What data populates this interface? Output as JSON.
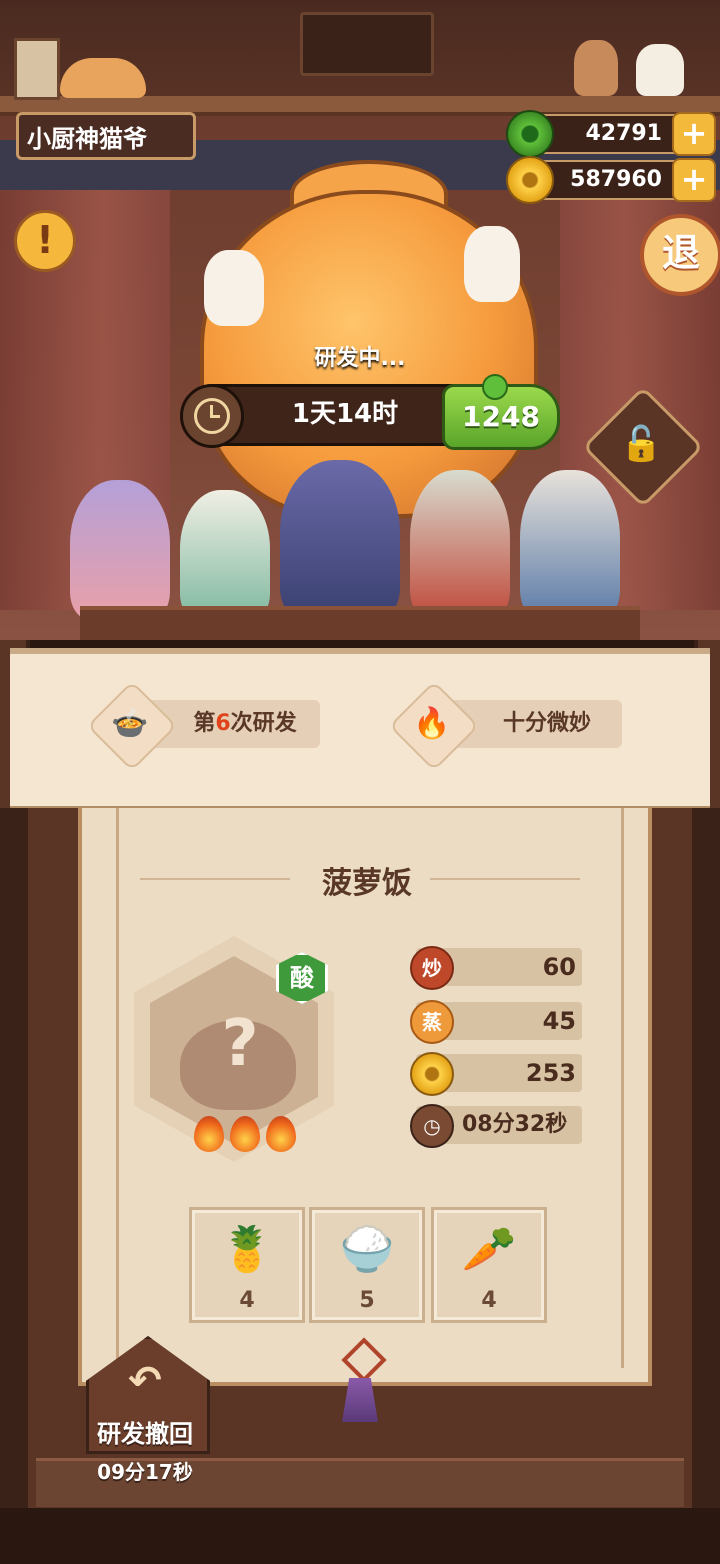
{
  "header": {
    "player_name": "小厨神猫爷",
    "jade_amount": "42791",
    "coin_amount": "587960",
    "plus_label": "+",
    "alert_label": "!",
    "exit_label": "退"
  },
  "research": {
    "status": "研发中...",
    "time_remaining": "1天14时",
    "speedup_cost": "1248"
  },
  "banner": {
    "attempt_prefix": "第",
    "attempt_number": "6",
    "attempt_suffix": "次研发",
    "hint": "十分微妙"
  },
  "dish": {
    "name": "菠萝饭",
    "flavor_tag": "酸",
    "unknown_mark": "?",
    "flame_count": 3,
    "stats": {
      "stir_fry_label": "炒",
      "stir_fry": "60",
      "steam_label": "蒸",
      "steam": "45",
      "price": "253",
      "cook_time": "08分32秒"
    },
    "ingredients": [
      {
        "icon": "pineapple-banana-icon",
        "count": "4"
      },
      {
        "icon": "rice-bowl-icon",
        "count": "5"
      },
      {
        "icon": "carrot-icon",
        "count": "4"
      }
    ]
  },
  "undo": {
    "label": "研发撤回",
    "timer": "09分17秒"
  },
  "colors": {
    "accent_orange": "#f59a3c",
    "speed_green": "#5aa52a",
    "highlight_red": "#e0431c",
    "flavor_green": "#3e9a3a"
  }
}
